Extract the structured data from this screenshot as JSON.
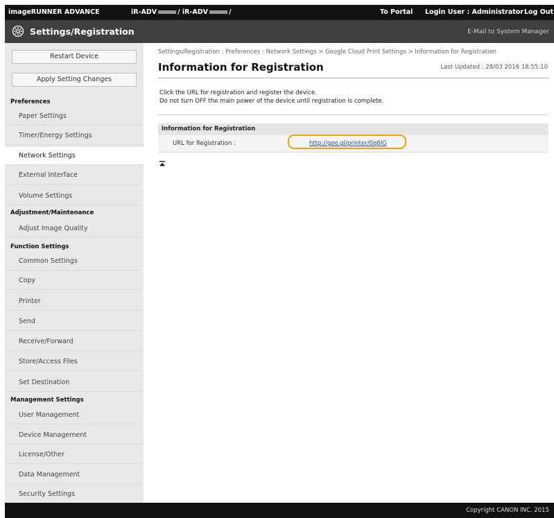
{
  "topbar": {
    "brand": "imageRUNNER ADVANCE",
    "device_prefix": "iR-ADV",
    "device_separator": "/ iR-ADV",
    "device_suffix": "/",
    "to_portal": "To Portal",
    "login_user": "Login User :  Administrator",
    "logout": "Log Out"
  },
  "titlebar": {
    "icon": "gear-icon",
    "title": "Settings/Registration",
    "email_link": "E-Mail to System Manager"
  },
  "sidebar": {
    "restart_button": "Restart Device",
    "apply_button": "Apply Setting Changes",
    "sections": [
      {
        "heading": "Preferences",
        "items": [
          {
            "label": "Paper Settings",
            "active": false
          },
          {
            "label": "Timer/Energy Settings",
            "active": false
          },
          {
            "label": "Network Settings",
            "active": true
          },
          {
            "label": "External Interface",
            "active": false
          },
          {
            "label": "Volume Settings",
            "active": false
          }
        ]
      },
      {
        "heading": "Adjustment/Maintenance",
        "items": [
          {
            "label": "Adjust Image Quality",
            "active": false
          }
        ]
      },
      {
        "heading": "Function Settings",
        "items": [
          {
            "label": "Common Settings",
            "active": false
          },
          {
            "label": "Copy",
            "active": false
          },
          {
            "label": "Printer",
            "active": false
          },
          {
            "label": "Send",
            "active": false
          },
          {
            "label": "Receive/Forward",
            "active": false
          },
          {
            "label": "Store/Access Files",
            "active": false
          }
        ]
      },
      {
        "heading": "",
        "items": [
          {
            "label": "Set Destination",
            "active": false
          }
        ]
      },
      {
        "heading": "Management Settings",
        "items": [
          {
            "label": "User Management",
            "active": false
          },
          {
            "label": "Device Management",
            "active": false
          },
          {
            "label": "License/Other",
            "active": false
          },
          {
            "label": "Data Management",
            "active": false
          },
          {
            "label": "Security Settings",
            "active": false
          }
        ]
      }
    ]
  },
  "main": {
    "breadcrumb": "Settings/Registration : Preferences : Network Settings > Google Cloud Print Settings > Information for Registration",
    "title": "Information for Registration",
    "last_updated": "Last Updated : 28/03 2016 18:55:10",
    "description_line1": "Click the URL for registration and register the device.",
    "description_line2": "Do not turn OFF the main power of the device until registration is complete.",
    "section_heading": "Information for Registration",
    "url_label": "URL for Registration :",
    "url_value": "http://goo.gl/printer/0q6lG",
    "back_to_top_icon": "back-to-top-icon",
    "highlight_color": "#f2a100"
  },
  "footer": {
    "copyright": "Copyright CANON INC. 2015"
  }
}
